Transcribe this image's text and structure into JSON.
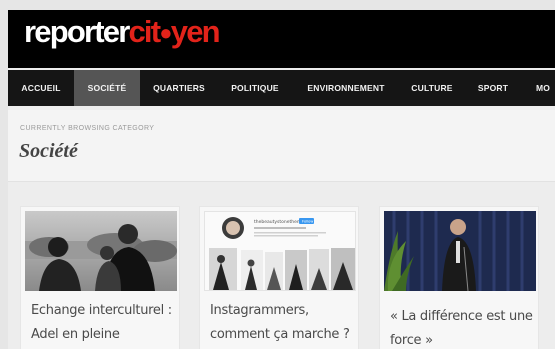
{
  "brand": {
    "part1": "reporter",
    "part2a": "cit",
    "part2b": "yen",
    "dot": "●"
  },
  "nav": {
    "items": [
      {
        "label": "ACCUEIL"
      },
      {
        "label": "SOCIÉTÉ",
        "active": true
      },
      {
        "label": "QUARTIERS"
      },
      {
        "label": "POLITIQUE"
      },
      {
        "label": "ENVIRONNEMENT"
      },
      {
        "label": "CULTURE"
      },
      {
        "label": "SPORT"
      },
      {
        "label": "MO"
      }
    ]
  },
  "category": {
    "breadcrumb": "CURRENTLY BROWSING CATEGORY",
    "title": "Société"
  },
  "posts": [
    {
      "title": "Echange interculturel : Adel en pleine"
    },
    {
      "title": "Instagrammers, comment ça marche ?",
      "profile_name": "thebeautystonetheme",
      "follow_label": "Follow"
    },
    {
      "title": "« La différence est une force »"
    }
  ],
  "colors": {
    "brand_red": "#e2231a",
    "header_bg": "#000000",
    "nav_bg": "#151515",
    "nav_active": "#555555"
  }
}
